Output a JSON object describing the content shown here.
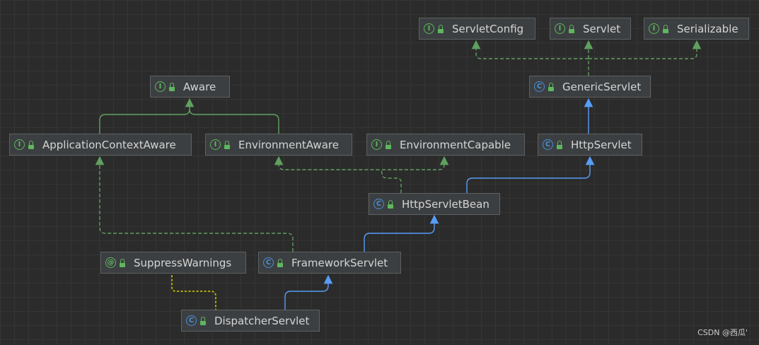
{
  "nodes": [
    {
      "id": "servletconfig",
      "label": "ServletConfig",
      "kind": "I"
    },
    {
      "id": "servlet",
      "label": "Servlet",
      "kind": "I"
    },
    {
      "id": "serializable",
      "label": "Serializable",
      "kind": "I"
    },
    {
      "id": "aware",
      "label": "Aware",
      "kind": "I"
    },
    {
      "id": "genericservlet",
      "label": "GenericServlet",
      "kind": "C"
    },
    {
      "id": "applicationcontextaware",
      "label": "ApplicationContextAware",
      "kind": "I"
    },
    {
      "id": "environmentaware",
      "label": "EnvironmentAware",
      "kind": "I"
    },
    {
      "id": "environmentcapable",
      "label": "EnvironmentCapable",
      "kind": "I"
    },
    {
      "id": "httpservlet",
      "label": "HttpServlet",
      "kind": "C"
    },
    {
      "id": "httpservletbean",
      "label": "HttpServletBean",
      "kind": "C"
    },
    {
      "id": "suppresswarnings",
      "label": "SuppressWarnings",
      "kind": "@"
    },
    {
      "id": "frameworkservlet",
      "label": "FrameworkServlet",
      "kind": "C"
    },
    {
      "id": "dispatcherservlet",
      "label": "DispatcherServlet",
      "kind": "C"
    }
  ],
  "relations": [
    {
      "from": "genericservlet",
      "to": "servletconfig",
      "type": "implements"
    },
    {
      "from": "genericservlet",
      "to": "servlet",
      "type": "implements"
    },
    {
      "from": "genericservlet",
      "to": "serializable",
      "type": "implements"
    },
    {
      "from": "applicationcontextaware",
      "to": "aware",
      "type": "extends-interface"
    },
    {
      "from": "environmentaware",
      "to": "aware",
      "type": "extends-interface"
    },
    {
      "from": "httpservlet",
      "to": "genericservlet",
      "type": "extends"
    },
    {
      "from": "httpservletbean",
      "to": "httpservlet",
      "type": "extends"
    },
    {
      "from": "httpservletbean",
      "to": "environmentaware",
      "type": "implements"
    },
    {
      "from": "httpservletbean",
      "to": "environmentcapable",
      "type": "implements"
    },
    {
      "from": "frameworkservlet",
      "to": "httpservletbean",
      "type": "extends"
    },
    {
      "from": "frameworkservlet",
      "to": "applicationcontextaware",
      "type": "implements"
    },
    {
      "from": "dispatcherservlet",
      "to": "frameworkservlet",
      "type": "extends"
    },
    {
      "from": "dispatcherservlet",
      "to": "suppresswarnings",
      "type": "annotated"
    }
  ],
  "colors": {
    "background": "#2b2b2b",
    "grid": "#353535",
    "node_fill": "#3c3f41",
    "node_border": "#5e6060",
    "node_text": "#d4d4d4",
    "interface_icon": "#5eb75e",
    "class_icon": "#4a8ed8",
    "extends_line": "#589df6",
    "implements_line": "#5fa05f",
    "annotation_line": "#b5b100"
  },
  "watermark": "CSDN @西瓜'"
}
